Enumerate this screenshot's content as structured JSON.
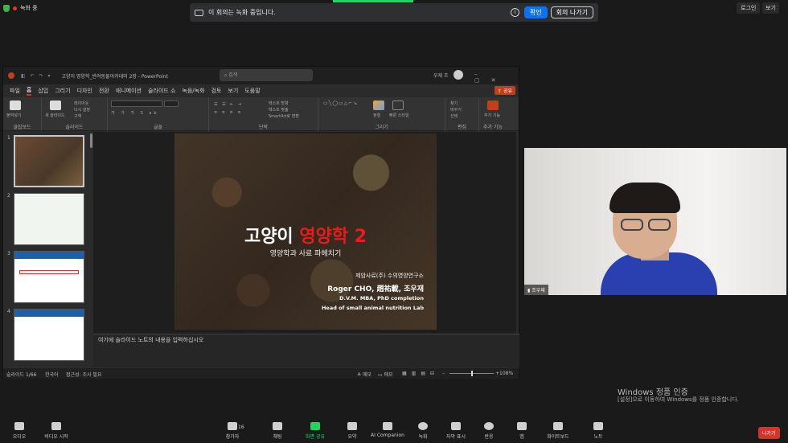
{
  "zoom": {
    "recording_label": "녹화 중",
    "banner_text": "이 회의는 녹화 중입니다.",
    "confirm_label": "확인",
    "leave_label": "회의 나가기",
    "login_label": "로그인",
    "view_label": "보기",
    "participant_name": "조우재",
    "participant_count": "16",
    "toolbar": {
      "audio": "오디오",
      "video": "비디오 시작",
      "participants": "참가자",
      "chat": "채팅",
      "share": "화면 공유",
      "summary": "요약",
      "ai": "AI Companion",
      "record": "녹화",
      "captions": "자막 표시",
      "reactions": "반응",
      "apps": "앱",
      "whiteboard": "화이트보드",
      "notes": "노트",
      "leave": "나가기"
    },
    "accent_green": "#1ed760",
    "accent_blue": "#0e72ed",
    "danger_red": "#d9322b"
  },
  "powerpoint": {
    "title": "고양이 영양학_반려동물아카데미 2장 - PowerPoint",
    "search_placeholder": "검색",
    "user": "우재 조",
    "share": "공유",
    "menu": [
      "파일",
      "홈",
      "삽입",
      "그리기",
      "디자인",
      "전환",
      "애니메이션",
      "슬라이드 쇼",
      "녹음/녹화",
      "검토",
      "보기",
      "도움말"
    ],
    "ribbon_groups": {
      "clipboard": "클립보드",
      "slides": "슬라이드",
      "font": "글꼴",
      "paragraph": "단락",
      "drawing": "그리기",
      "editing": "편집",
      "addins": "추가 기능"
    },
    "ribbon_items": {
      "paste": "붙여넣기",
      "new_slide": "새 슬라이드",
      "layout": "레이아웃",
      "reset": "다시 설정",
      "section": "구역",
      "text_direction": "텍스트 방향",
      "text_align": "텍스트 맞춤",
      "smartart": "SmartArt로 변환",
      "arrange": "정렬",
      "quick_styles": "빠른 스타일",
      "find": "찾기",
      "replace": "바꾸기",
      "select": "선택",
      "addins_btn": "추가 기능"
    },
    "thumbnail_numbers": [
      "1",
      "2",
      "3",
      "4"
    ],
    "notes_placeholder": "여기에 슬라이드 노트의 내용을 입력하십시오",
    "status": {
      "slide": "슬라이드 1/66",
      "language": "한국어",
      "accessibility": "접근성: 조사 필요",
      "notes": "메모",
      "comments": "메모",
      "zoom": "108%"
    },
    "slide": {
      "title_a": "고양이 ",
      "title_b": "영양학 2",
      "subtitle": "영양학과 사료 파헤치기",
      "org": "제암사료(주) 수의영양연구소",
      "name": "Roger CHO, 趙祐載, 조우재",
      "degree": "D.V.M. MBA, PhD completion",
      "lab": "Head of small animal nutrition Lab"
    },
    "accent": "#c43e1c"
  },
  "windows": {
    "activation_title": "Windows 정품 인증",
    "activation_sub": "[설정]으로 이동하여 Windows를 정품 인증합니다."
  }
}
